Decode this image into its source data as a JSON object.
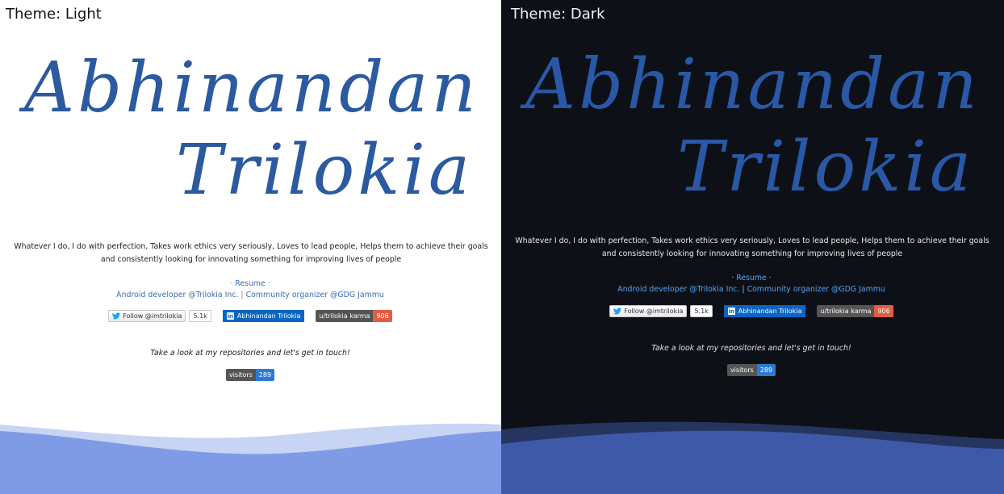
{
  "panels": {
    "light": {
      "theme_label": "Theme: Light"
    },
    "dark": {
      "theme_label": "Theme: Dark"
    }
  },
  "profile": {
    "first_name": "Abhinandan",
    "last_name": "Trilokia",
    "bio": "Whatever I do, I do with perfection, Takes work ethics very seriously, Loves to lead people, Helps them to achieve their goals and consistently looking for innovating something for improving lives of people",
    "resume_label": "Resume",
    "bullet": "·",
    "role1": "Android developer @Trilokia Inc.",
    "role_sep": "|",
    "role2": "Community organizer @GDG Jammu",
    "tagline": "Take a look at my repositories and let's get in touch!"
  },
  "badges": {
    "twitter_follow": "Follow @imtrilokia",
    "twitter_count": "5.1k",
    "linkedin": "Abhinandan Trilokia",
    "reddit_label": "u/trilokia karma",
    "reddit_value": "906",
    "visitors_label": "visitors",
    "visitors_value": "289"
  },
  "colors": {
    "name_light": "#2c5aa0",
    "name_dark": "#2a58a6",
    "link_light": "#3a6fb5",
    "link_dark": "#5aa0f2",
    "wave_light_front": "#7f9be6",
    "wave_light_back": "#c8d4f4",
    "wave_dark_front": "#3d59a8",
    "wave_dark_back": "#26355f",
    "dark_bg": "#0d1117"
  }
}
